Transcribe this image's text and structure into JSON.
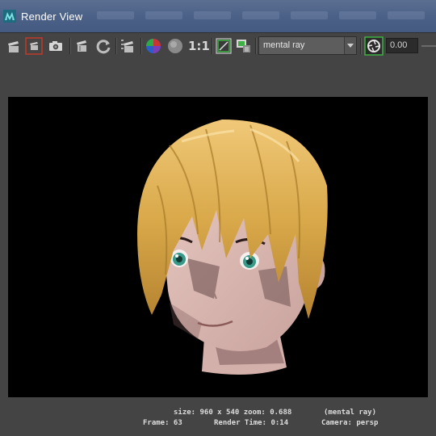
{
  "window": {
    "title": "Render View",
    "icon": "maya-app-icon"
  },
  "toolbar": {
    "icons": [
      "redo-previous-render-icon",
      "render-region-icon",
      "snapshot-icon",
      "render-sequence-icon",
      "refresh-ipr-icon",
      "ipr-render-icon",
      "rgb-channels-icon",
      "alpha-channel-icon",
      "frame-region-icon",
      "keep-image-icon",
      "stereo-toggle-icon"
    ],
    "ratio_label": "1:1",
    "renderer": "mental ray",
    "exposure_value": "0.00"
  },
  "status": {
    "size_zoom": "size: 960 x 540 zoom: 0.688",
    "renderer": "(mental ray)",
    "frame": "Frame: 63",
    "render_time": "Render Time: 0:14",
    "camera": "Camera: persp"
  },
  "colors": {
    "titlebar": "#4c6187",
    "panel": "#444444",
    "viewport": "#000000",
    "hair": "#d9a94a",
    "skin": "#d8b4ae",
    "eyes": "#3a9a8a"
  }
}
